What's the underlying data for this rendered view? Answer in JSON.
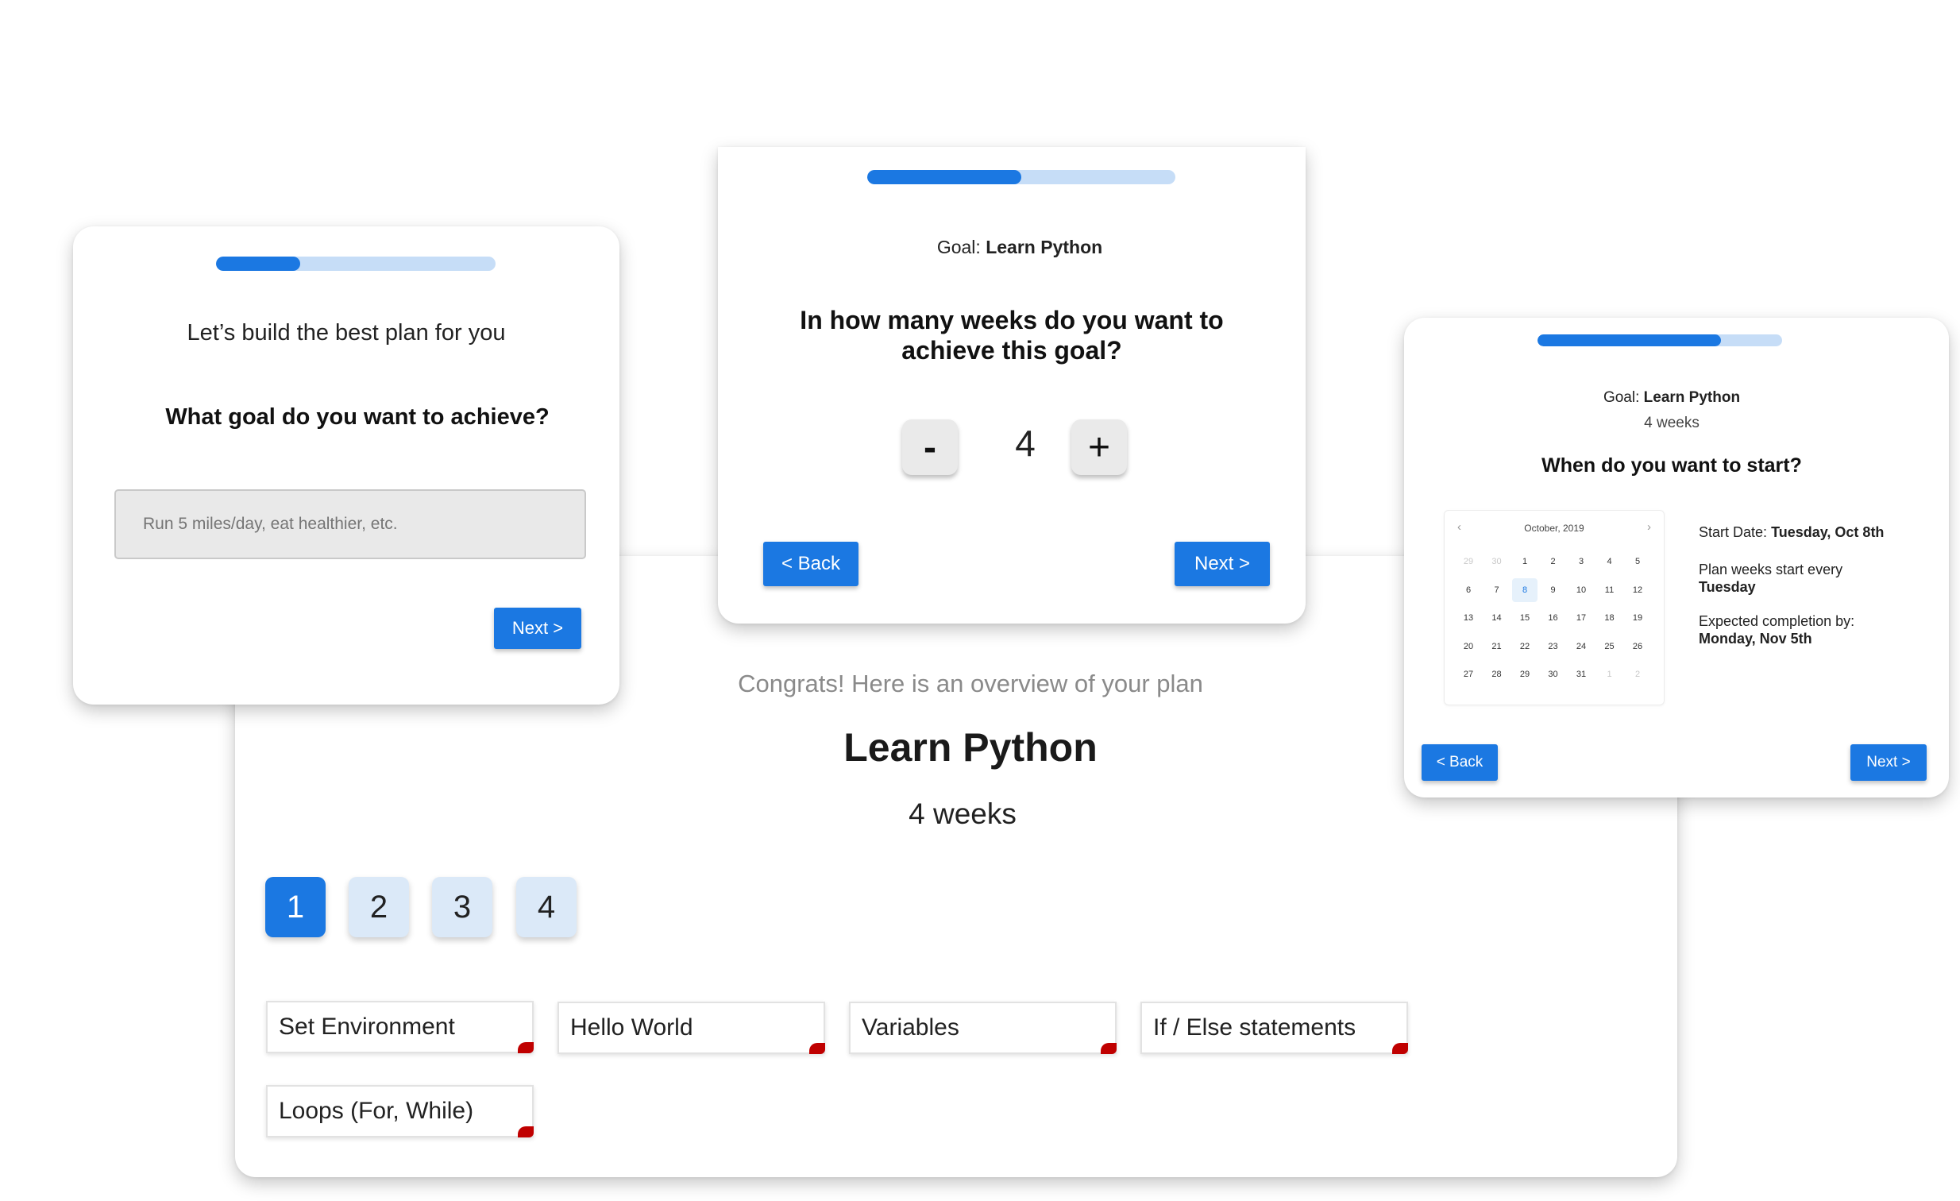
{
  "card_goal": {
    "progress": 0.3,
    "intro": "Let’s build the best plan for you",
    "question": "What goal do you want to achieve?",
    "input_placeholder": "Run 5 miles/day, eat healthier, etc.",
    "input_value": "",
    "next_label": "Next >"
  },
  "card_weeks": {
    "progress": 0.5,
    "goal_prefix": "Goal:",
    "goal_value": "Learn Python",
    "question_line1": "In how many weeks do you want to",
    "question_line2": "achieve this goal?",
    "decrement_label": "-",
    "weeks_value": "4",
    "increment_label": "+",
    "back_label": "< Back",
    "next_label": "Next >"
  },
  "card_start": {
    "progress": 0.75,
    "goal_prefix": "Goal:",
    "goal_value": "Learn Python",
    "weeks_text": "4 weeks",
    "question": "When do you want to start?",
    "calendar": {
      "month_label": "October, 2019",
      "prev_icon": "chevron-left-icon",
      "next_icon": "chevron-right-icon",
      "weeks": [
        [
          "29",
          "30",
          "1",
          "2",
          "3",
          "4",
          "5"
        ],
        [
          "6",
          "7",
          "8",
          "9",
          "10",
          "11",
          "12"
        ],
        [
          "13",
          "14",
          "15",
          "16",
          "17",
          "18",
          "19"
        ],
        [
          "20",
          "21",
          "22",
          "23",
          "24",
          "25",
          "26"
        ],
        [
          "27",
          "28",
          "29",
          "30",
          "31",
          "1",
          "2"
        ]
      ],
      "selected_day": "8"
    },
    "start_date_label": "Start Date:",
    "start_date_value": "Tuesday, Oct 8th",
    "plan_weeks_label": "Plan weeks start every",
    "plan_weeks_value": "Tuesday",
    "completion_label": "Expected completion by:",
    "completion_value": "Monday, Nov 5th",
    "back_label": "< Back",
    "next_label": "Next >"
  },
  "card_overview": {
    "congrats": "Congrats! Here is an overview of your plan",
    "title": "Learn Python",
    "duration": "4 weeks",
    "week_tabs": [
      "1",
      "2",
      "3",
      "4"
    ],
    "active_week": "1",
    "topics": [
      "Set Environment",
      "Hello World",
      "Variables",
      "If / Else statements",
      "Loops (For, While)"
    ]
  },
  "colors": {
    "accent": "#1b78e2",
    "progress_track": "#c6ddf7",
    "week_inactive": "#dbe9f8",
    "topic_flag": "#c00000"
  }
}
